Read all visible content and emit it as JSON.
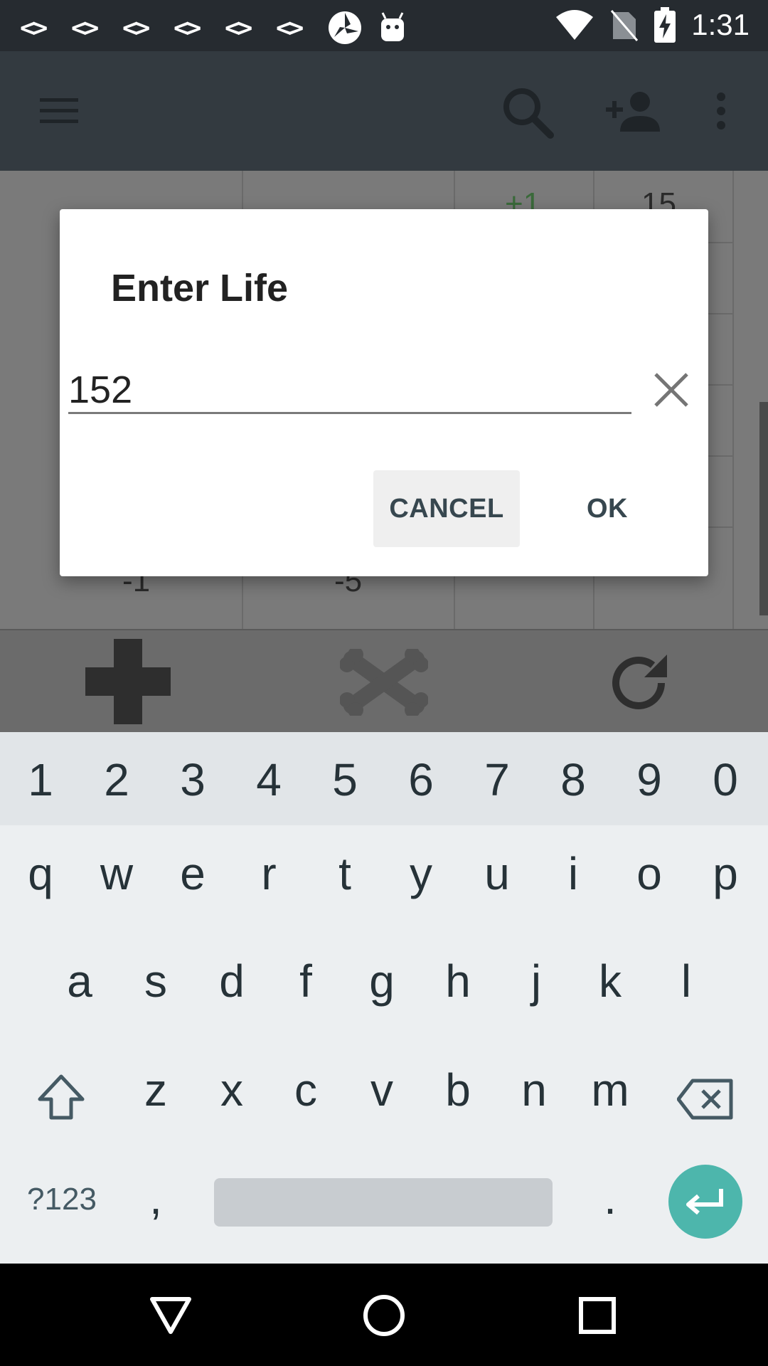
{
  "status_bar": {
    "time": "1:31",
    "notification_glyphs": [
      "<>",
      "<>",
      "<>",
      "<>",
      "<>",
      "<>"
    ]
  },
  "app_bar": {
    "menu_icon": "hamburger-icon",
    "search_icon": "search-icon",
    "add_person_icon": "person-add-icon",
    "overflow_icon": "more-vert-icon"
  },
  "background": {
    "numbers": [
      "+1",
      "15",
      "-1",
      "-5"
    ]
  },
  "dialog": {
    "title": "Enter Life",
    "input_value": "152",
    "cancel_label": "CANCEL",
    "ok_label": "OK"
  },
  "keyboard": {
    "numbers": [
      "1",
      "2",
      "3",
      "4",
      "5",
      "6",
      "7",
      "8",
      "9",
      "0"
    ],
    "row1": [
      "q",
      "w",
      "e",
      "r",
      "t",
      "y",
      "u",
      "i",
      "o",
      "p"
    ],
    "row2": [
      "a",
      "s",
      "d",
      "f",
      "g",
      "h",
      "j",
      "k",
      "l"
    ],
    "row3": [
      "z",
      "x",
      "c",
      "v",
      "b",
      "n",
      "m"
    ],
    "symbols_label": "?123",
    "comma": ",",
    "period": "."
  },
  "colors": {
    "app_bar": "#333a40",
    "status_bar": "#262b30",
    "accent": "#4db6ac",
    "button_text": "#37474f"
  }
}
